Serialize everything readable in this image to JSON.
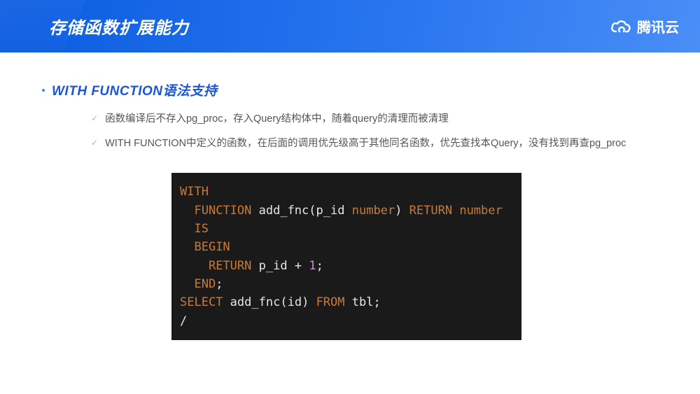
{
  "header": {
    "title": "存储函数扩展能力",
    "brand": "腾讯云"
  },
  "section": {
    "title": "WITH FUNCTION语法支持",
    "bullets": [
      "函数编译后不存入pg_proc，存入Query结构体中，随着query的清理而被清理",
      "WITH FUNCTION中定义的函数，在后面的调用优先级高于其他同名函数，优先查找本Query，没有找到再查pg_proc"
    ]
  },
  "code": {
    "t_with": "WITH",
    "t_function": "FUNCTION",
    "t_add_fnc": "add_fnc",
    "t_p_id": "p_id",
    "t_number": "number",
    "t_return_kw": "RETURN",
    "t_is": "IS",
    "t_begin": "BEGIN",
    "t_return": "RETURN",
    "t_plus": "+",
    "t_one": "1",
    "t_end": "END",
    "t_select": "SELECT",
    "t_id": "id",
    "t_from": "FROM",
    "t_tbl": "tbl",
    "t_slash": "/",
    "t_lp": "(",
    "t_rp": ")",
    "t_semi": ";"
  }
}
